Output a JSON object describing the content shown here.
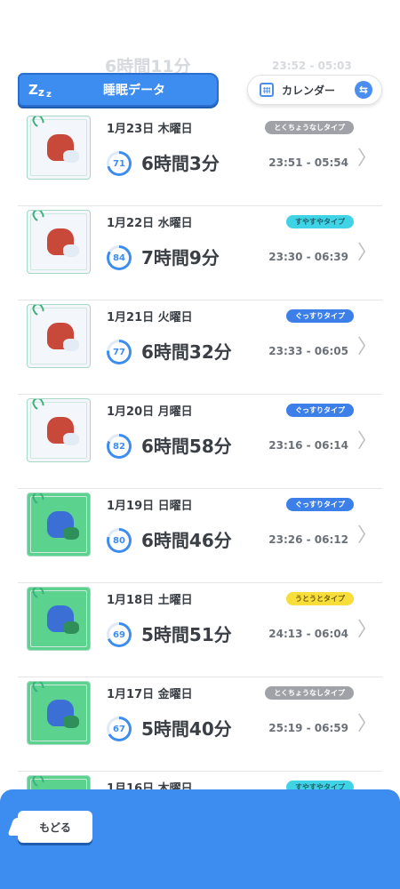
{
  "header": {
    "title": "睡眠データ",
    "calendar_label": "カレンダー",
    "ghost_duration": "6時間11分",
    "ghost_range": "23:52 - 05:03"
  },
  "colors": {
    "accent": "#3d8df0",
    "badge_gray": "#9fa3a8",
    "badge_cyan": "#40d3e6",
    "badge_blue": "#3d7fe8",
    "badge_yellow": "#f7de3a"
  },
  "entries": [
    {
      "date": "1月23日 木曜日",
      "type": "とくちょうなしタイプ",
      "type_color": "#9fa3a8",
      "type_text_color": "#ffffff",
      "score": 71,
      "duration": "6時間3分",
      "range": "23:51 - 05:54",
      "thumb": "snow"
    },
    {
      "date": "1月22日 水曜日",
      "type": "すやすやタイプ",
      "type_color": "#40d3e6",
      "type_text_color": "#1a5f6b",
      "score": 84,
      "duration": "7時間9分",
      "range": "23:30 - 06:39",
      "thumb": "snow"
    },
    {
      "date": "1月21日 火曜日",
      "type": "ぐっすりタイプ",
      "type_color": "#3d7fe8",
      "type_text_color": "#ffffff",
      "score": 77,
      "duration": "6時間32分",
      "range": "23:33 - 06:05",
      "thumb": "snow"
    },
    {
      "date": "1月20日 月曜日",
      "type": "ぐっすりタイプ",
      "type_color": "#3d7fe8",
      "type_text_color": "#ffffff",
      "score": 82,
      "duration": "6時間58分",
      "range": "23:16 - 06:14",
      "thumb": "snow"
    },
    {
      "date": "1月19日 日曜日",
      "type": "ぐっすりタイプ",
      "type_color": "#3d7fe8",
      "type_text_color": "#ffffff",
      "score": 80,
      "duration": "6時間46分",
      "range": "23:26 - 06:12",
      "thumb": "grass"
    },
    {
      "date": "1月18日 土曜日",
      "type": "うとうとタイプ",
      "type_color": "#f7de3a",
      "type_text_color": "#6b5a00",
      "score": 69,
      "duration": "5時間51分",
      "range": "24:13 - 06:04",
      "thumb": "grass"
    },
    {
      "date": "1月17日 金曜日",
      "type": "とくちょうなしタイプ",
      "type_color": "#9fa3a8",
      "type_text_color": "#ffffff",
      "score": 67,
      "duration": "5時間40分",
      "range": "25:19 - 06:59",
      "thumb": "grass"
    },
    {
      "date": "1月16日 木曜日",
      "type": "すやすやタイプ",
      "type_color": "#40d3e6",
      "type_text_color": "#1a5f6b",
      "score": null,
      "duration": "",
      "range": "",
      "thumb": "grass"
    }
  ],
  "footer": {
    "back_label": "もどる"
  }
}
